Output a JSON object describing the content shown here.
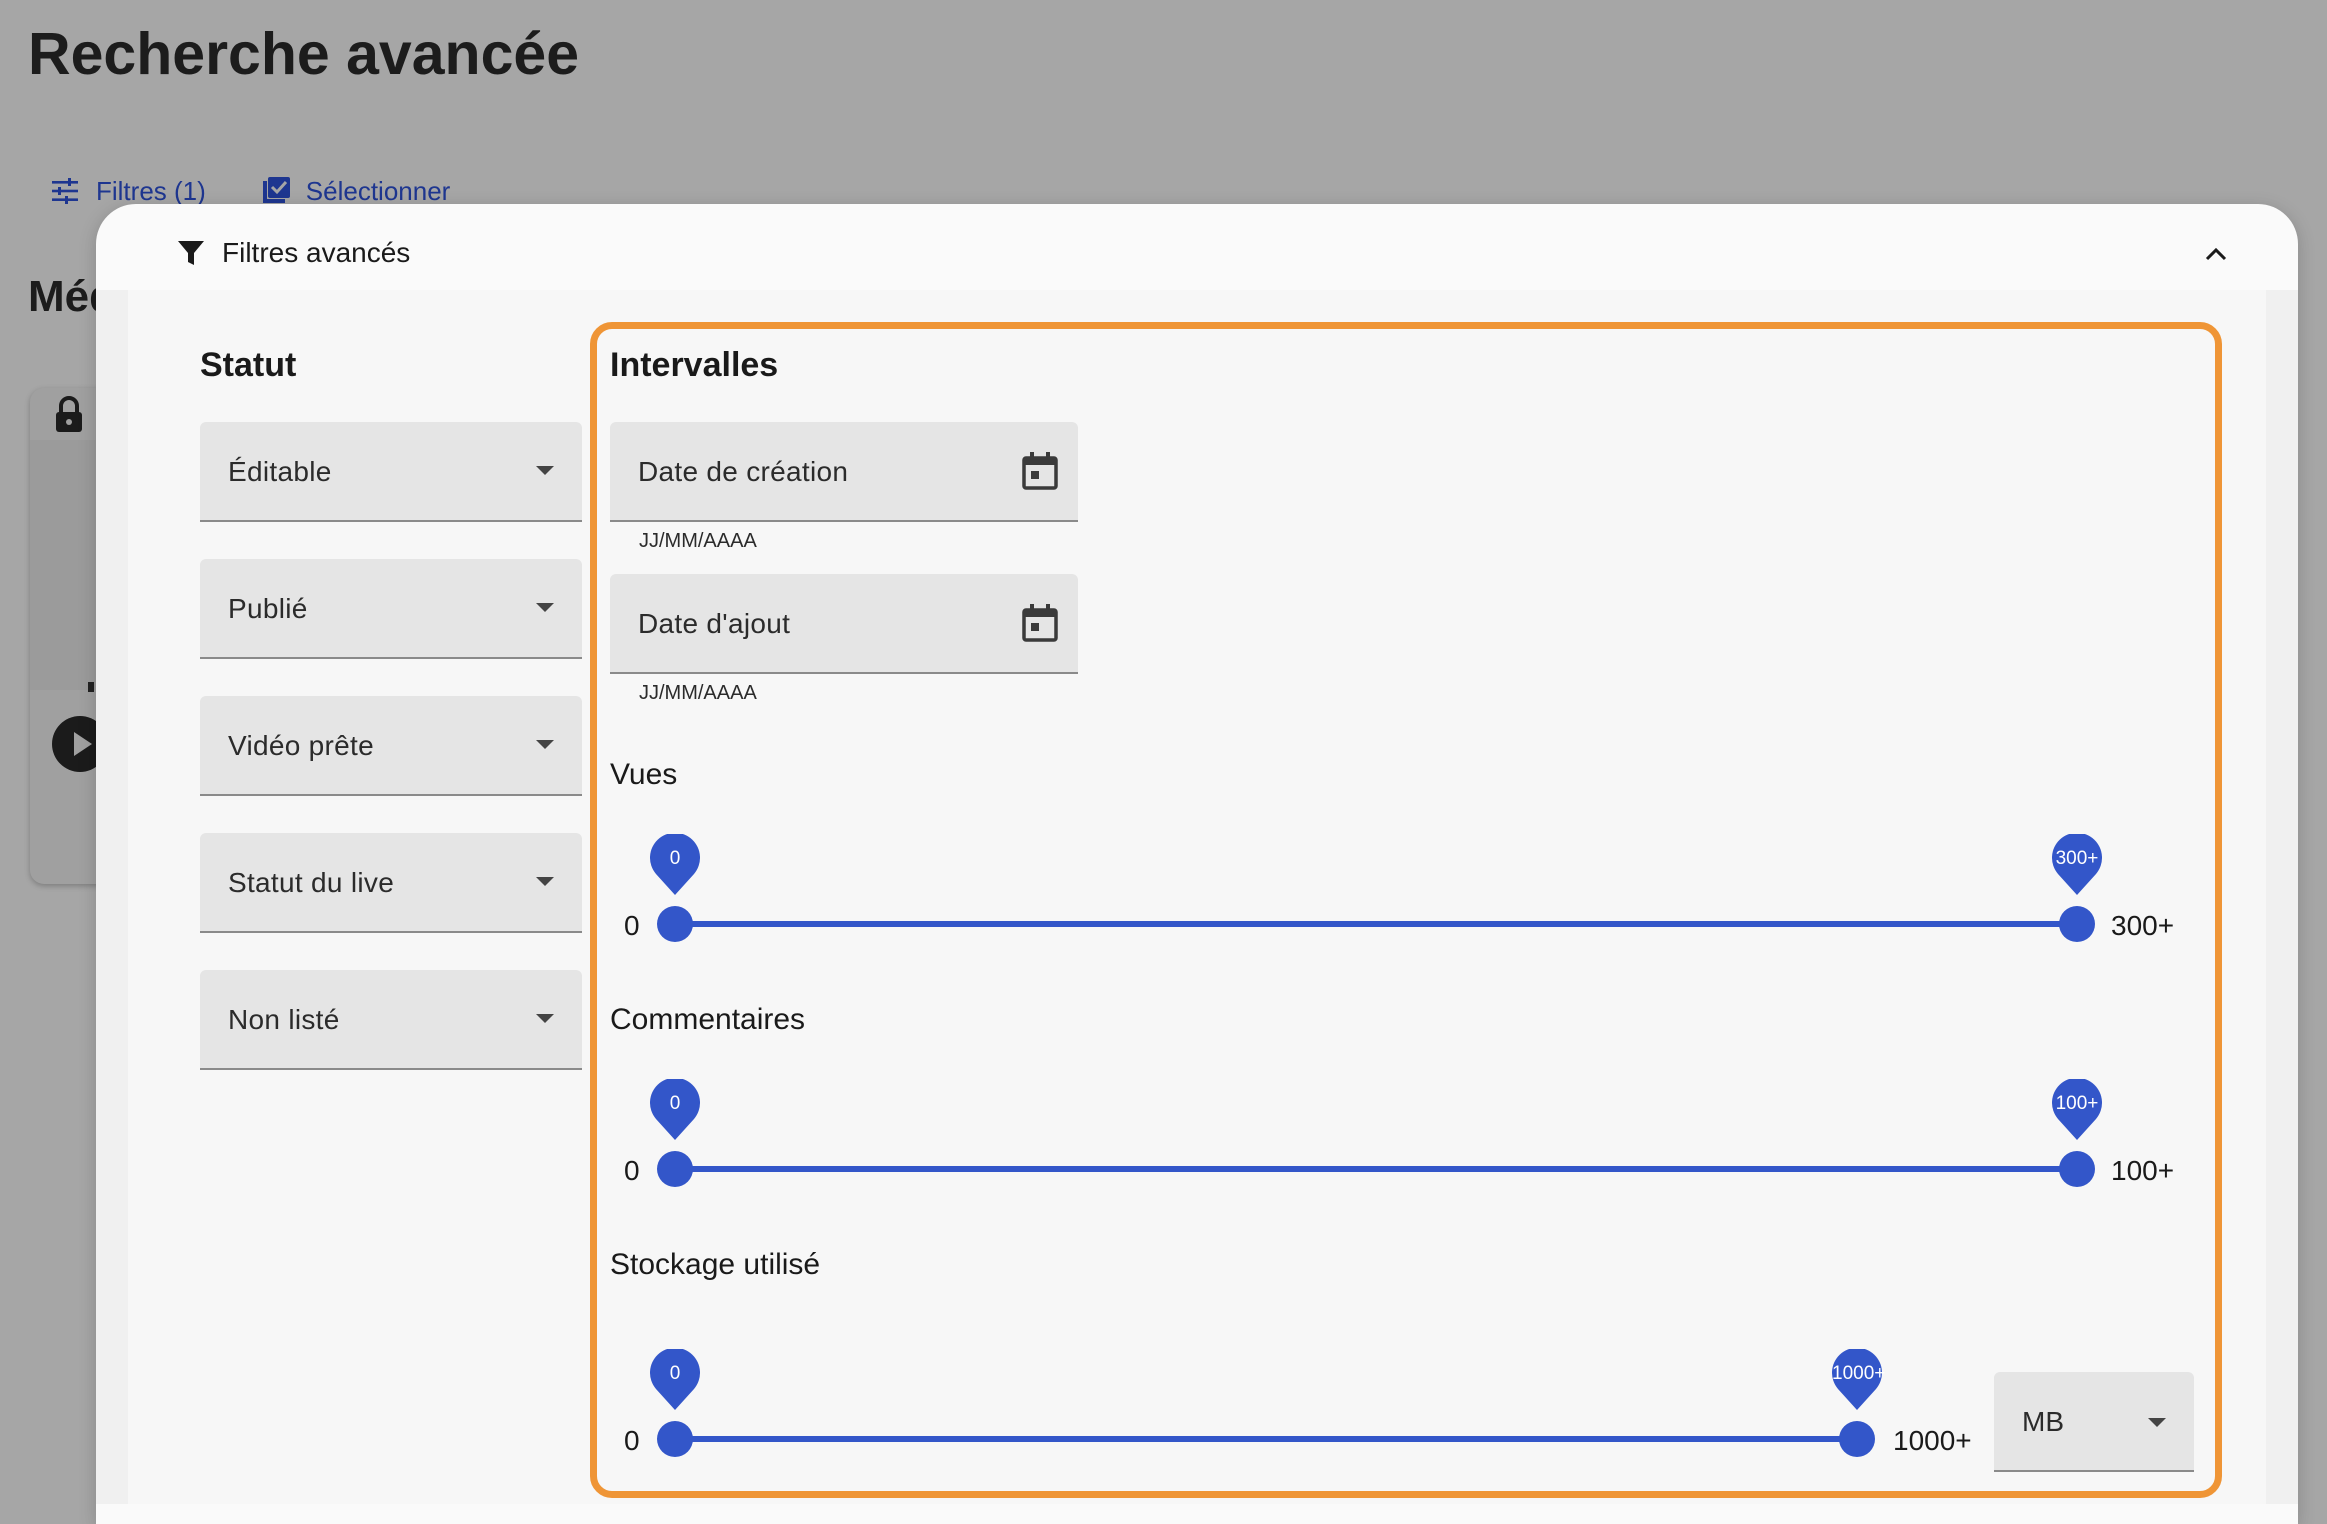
{
  "page": {
    "title": "Recherche avancée",
    "section_partial": "Méd"
  },
  "toolbar": {
    "filters_label": "Filtres (1)",
    "select_label": "Sélectionner"
  },
  "panel": {
    "title": "Filtres avancés",
    "status_heading": "Statut",
    "intervals_heading": "Intervalles"
  },
  "status_filters": [
    {
      "label": "Éditable"
    },
    {
      "label": "Publié"
    },
    {
      "label": "Vidéo prête"
    },
    {
      "label": "Statut du live"
    },
    {
      "label": "Non listé"
    }
  ],
  "date_fields": [
    {
      "label": "Date de création",
      "helper": "JJ/MM/AAAA"
    },
    {
      "label": "Date d'ajout",
      "helper": "JJ/MM/AAAA"
    }
  ],
  "sliders": [
    {
      "title": "Vues",
      "min_label": "0",
      "max_label": "300+",
      "min_value": 0,
      "max_value": 300,
      "low": 0,
      "high": 300,
      "low_pin": "0",
      "high_pin": "300+"
    },
    {
      "title": "Commentaires",
      "min_label": "0",
      "max_label": "100+",
      "min_value": 0,
      "max_value": 100,
      "low": 0,
      "high": 100,
      "low_pin": "0",
      "high_pin": "100+"
    },
    {
      "title": "Stockage utilisé",
      "min_label": "0",
      "max_label": "1000+",
      "min_value": 0,
      "max_value": 1000,
      "low": 0,
      "high": 1000,
      "low_pin": "0",
      "high_pin": "1000+"
    }
  ],
  "storage_unit": {
    "selected": "MB"
  },
  "icons": {
    "filters": "tune-icon",
    "select": "checkbox-icon",
    "panel": "filter-icon",
    "collapse": "chevron-up-icon",
    "date": "calendar-icon",
    "dropdown": "arrow-drop-down-icon"
  },
  "colors": {
    "accent": "#3356c9",
    "highlight": "#ef9536",
    "link": "#1e3690"
  }
}
